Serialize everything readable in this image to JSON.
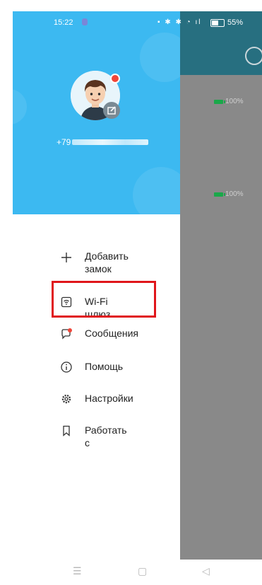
{
  "status_bar": {
    "time": "15:22",
    "battery": "55%"
  },
  "profile": {
    "phone_prefix": "+79"
  },
  "menu": {
    "items": [
      {
        "label": "Добавить\nзамок",
        "icon": "plus-icon"
      },
      {
        "label": "Wi-Fi шлюз",
        "icon": "wifi-gateway-icon",
        "highlighted": true
      },
      {
        "label": "Сообщения",
        "icon": "message-icon"
      },
      {
        "label": "Помощь",
        "icon": "info-icon"
      },
      {
        "label": "Настройки",
        "icon": "gear-icon"
      },
      {
        "label": "Работать с",
        "icon": "bookmark-icon"
      }
    ]
  },
  "background_list": {
    "battery_labels": [
      "100%",
      "100%"
    ]
  },
  "colors": {
    "drawer_header": "#3cb9f1",
    "highlight_box": "#e0161b",
    "battery_green": "#1aa84a",
    "dim_overlay": "#898989"
  }
}
